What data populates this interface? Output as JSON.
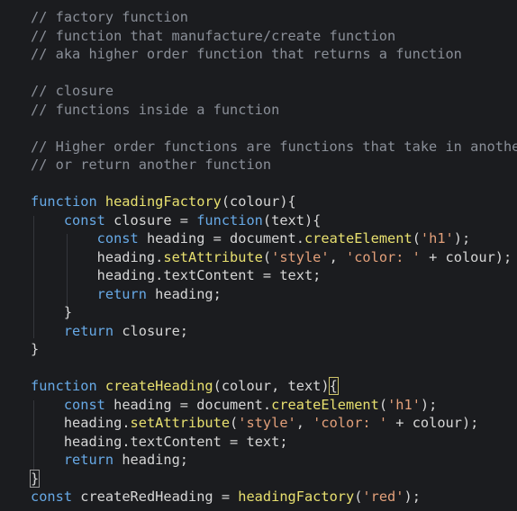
{
  "editor": {
    "lines": [
      [
        {
          "t": "// factory function",
          "c": "c"
        }
      ],
      [
        {
          "t": "// function that manufacture/create function",
          "c": "c"
        }
      ],
      [
        {
          "t": "// aka higher order function that returns a function",
          "c": "c"
        }
      ],
      [],
      [
        {
          "t": "// closure",
          "c": "c"
        }
      ],
      [
        {
          "t": "// functions inside a function",
          "c": "c"
        }
      ],
      [],
      [
        {
          "t": "// Higher order functions are functions that take in another",
          "c": "c"
        }
      ],
      [
        {
          "t": "// or return another function",
          "c": "c"
        }
      ],
      [],
      [
        {
          "t": "function ",
          "c": "k"
        },
        {
          "t": "headingFactory",
          "c": "f"
        },
        {
          "t": "(",
          "c": "p"
        },
        {
          "t": "colour",
          "c": "v"
        },
        {
          "t": "){",
          "c": "p"
        }
      ],
      [
        {
          "t": "    const ",
          "c": "k"
        },
        {
          "t": "closure",
          "c": "v"
        },
        {
          "t": " = ",
          "c": "p"
        },
        {
          "t": "function",
          "c": "k"
        },
        {
          "t": "(",
          "c": "p"
        },
        {
          "t": "text",
          "c": "v"
        },
        {
          "t": "){",
          "c": "p"
        }
      ],
      [
        {
          "t": "        const ",
          "c": "k"
        },
        {
          "t": "heading",
          "c": "v"
        },
        {
          "t": " = ",
          "c": "p"
        },
        {
          "t": "document",
          "c": "v"
        },
        {
          "t": ".",
          "c": "p"
        },
        {
          "t": "createElement",
          "c": "f"
        },
        {
          "t": "(",
          "c": "p"
        },
        {
          "t": "'h1'",
          "c": "s"
        },
        {
          "t": ");",
          "c": "p"
        }
      ],
      [
        {
          "t": "        heading",
          "c": "v"
        },
        {
          "t": ".",
          "c": "p"
        },
        {
          "t": "setAttribute",
          "c": "f"
        },
        {
          "t": "(",
          "c": "p"
        },
        {
          "t": "'style'",
          "c": "s"
        },
        {
          "t": ", ",
          "c": "p"
        },
        {
          "t": "'color: '",
          "c": "s"
        },
        {
          "t": " + ",
          "c": "p"
        },
        {
          "t": "colour",
          "c": "v"
        },
        {
          "t": ");",
          "c": "p"
        }
      ],
      [
        {
          "t": "        heading",
          "c": "v"
        },
        {
          "t": ".",
          "c": "p"
        },
        {
          "t": "textContent",
          "c": "v"
        },
        {
          "t": " = ",
          "c": "p"
        },
        {
          "t": "text",
          "c": "v"
        },
        {
          "t": ";",
          "c": "p"
        }
      ],
      [
        {
          "t": "        return ",
          "c": "k"
        },
        {
          "t": "heading",
          "c": "v"
        },
        {
          "t": ";",
          "c": "p"
        }
      ],
      [
        {
          "t": "    }",
          "c": "p"
        }
      ],
      [
        {
          "t": "    return ",
          "c": "k"
        },
        {
          "t": "closure",
          "c": "v"
        },
        {
          "t": ";",
          "c": "p"
        }
      ],
      [
        {
          "t": "}",
          "c": "p"
        }
      ],
      [],
      [
        {
          "t": "function ",
          "c": "k"
        },
        {
          "t": "createHeading",
          "c": "f"
        },
        {
          "t": "(",
          "c": "p"
        },
        {
          "t": "colour",
          "c": "v"
        },
        {
          "t": ", ",
          "c": "p"
        },
        {
          "t": "text",
          "c": "v"
        },
        {
          "t": ")",
          "c": "p"
        },
        {
          "t": "{",
          "c": "p",
          "h": "hl"
        }
      ],
      [
        {
          "t": "    const ",
          "c": "k"
        },
        {
          "t": "heading",
          "c": "v"
        },
        {
          "t": " = ",
          "c": "p"
        },
        {
          "t": "document",
          "c": "v"
        },
        {
          "t": ".",
          "c": "p"
        },
        {
          "t": "createElement",
          "c": "f"
        },
        {
          "t": "(",
          "c": "p"
        },
        {
          "t": "'h1'",
          "c": "s"
        },
        {
          "t": ");",
          "c": "p"
        }
      ],
      [
        {
          "t": "    heading",
          "c": "v"
        },
        {
          "t": ".",
          "c": "p"
        },
        {
          "t": "setAttribute",
          "c": "f"
        },
        {
          "t": "(",
          "c": "p"
        },
        {
          "t": "'style'",
          "c": "s"
        },
        {
          "t": ", ",
          "c": "p"
        },
        {
          "t": "'color: '",
          "c": "s"
        },
        {
          "t": " + ",
          "c": "p"
        },
        {
          "t": "colour",
          "c": "v"
        },
        {
          "t": ");",
          "c": "p"
        }
      ],
      [
        {
          "t": "    heading",
          "c": "v"
        },
        {
          "t": ".",
          "c": "p"
        },
        {
          "t": "textContent",
          "c": "v"
        },
        {
          "t": " = ",
          "c": "p"
        },
        {
          "t": "text",
          "c": "v"
        },
        {
          "t": ";",
          "c": "p"
        }
      ],
      [
        {
          "t": "    return ",
          "c": "k"
        },
        {
          "t": "heading",
          "c": "v"
        },
        {
          "t": ";",
          "c": "p"
        }
      ],
      [
        {
          "t": "}",
          "c": "p",
          "h": "hl2"
        }
      ],
      [
        {
          "t": "const ",
          "c": "k"
        },
        {
          "t": "createRedHeading",
          "c": "v"
        },
        {
          "t": " = ",
          "c": "p"
        },
        {
          "t": "headingFactory",
          "c": "f"
        },
        {
          "t": "(",
          "c": "p"
        },
        {
          "t": "'red'",
          "c": "s"
        },
        {
          "t": ");",
          "c": "p"
        }
      ]
    ]
  }
}
